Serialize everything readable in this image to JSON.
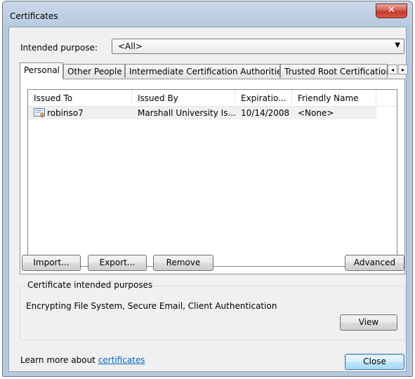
{
  "window": {
    "title": "Certificates",
    "close_symbol": "✕"
  },
  "purpose": {
    "label": "Intended purpose:",
    "value": "<All>"
  },
  "tabs": [
    {
      "label": "Personal",
      "active": true
    },
    {
      "label": "Other People",
      "active": false
    },
    {
      "label": "Intermediate Certification Authorities",
      "active": false
    },
    {
      "label": "Trusted Root Certification",
      "active": false
    }
  ],
  "tab_scroll": {
    "left": "◂",
    "right": "▸"
  },
  "list": {
    "columns": [
      "Issued To",
      "Issued By",
      "Expiratio...",
      "Friendly Name"
    ],
    "rows": [
      {
        "issued_to": "robinso7",
        "issued_by": "Marshall University Is...",
        "expiration": "10/14/2008",
        "friendly_name": "<None>"
      }
    ]
  },
  "buttons": {
    "import": "Import...",
    "export": "Export...",
    "remove": "Remove",
    "advanced": "Advanced",
    "view": "View",
    "close": "Close"
  },
  "purposes_group": {
    "title": "Certificate intended purposes",
    "text": "Encrypting File System, Secure Email, Client Authentication"
  },
  "footer": {
    "learn_prefix": "Learn more about ",
    "learn_link": "certificates"
  },
  "colors": {
    "link": "#0066cc",
    "close_button": "#c0392b",
    "default_button_border": "#3c7fb1"
  }
}
